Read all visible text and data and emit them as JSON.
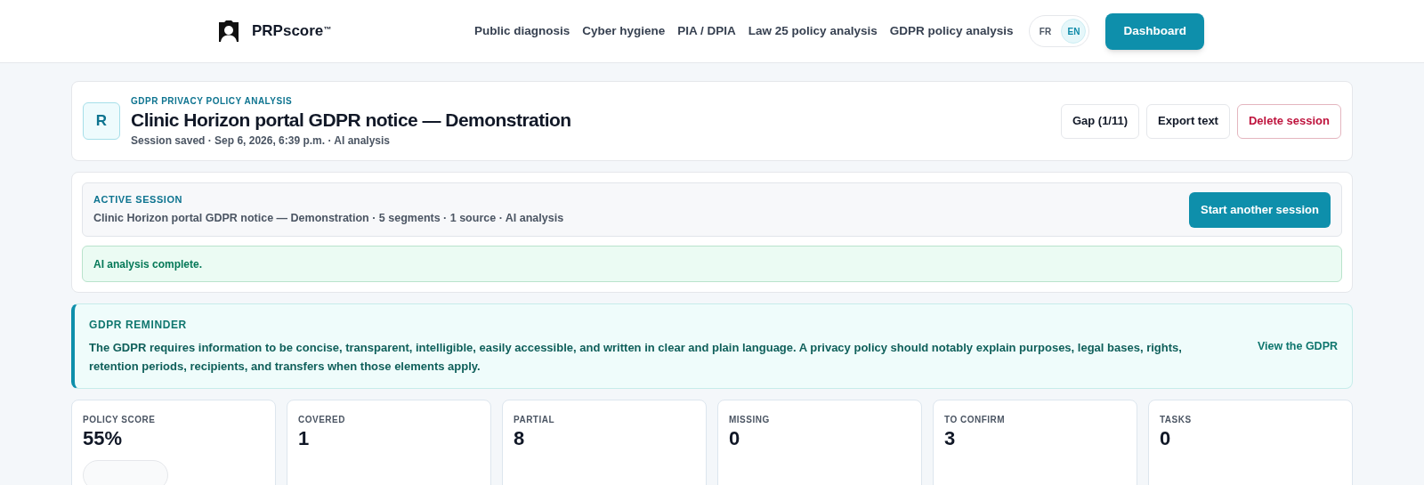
{
  "header": {
    "brand": "PRPscore",
    "brand_mark": "™",
    "nav": [
      "Public diagnosis",
      "Cyber hygiene",
      "PIA / DPIA",
      "Law 25 policy analysis",
      "GDPR policy analysis"
    ],
    "languages": [
      {
        "label": "FR",
        "selected": false
      },
      {
        "label": "EN",
        "selected": true
      }
    ],
    "cta": "Dashboard"
  },
  "session_card": {
    "avatar": "R",
    "eyebrow": "GDPR PRIVACY POLICY ANALYSIS",
    "title": "Clinic Horizon portal GDPR notice — Demonstration",
    "meta": "Session saved · Sep 6, 2026, 6:39 p.m. · AI analysis",
    "actions": [
      {
        "label": "Gap (1/11)",
        "kind": "default"
      },
      {
        "label": "Export text",
        "kind": "default"
      },
      {
        "label": "Delete session",
        "kind": "danger"
      }
    ]
  },
  "active_session": {
    "eyebrow": "ACTIVE SESSION",
    "summary": "Clinic Horizon portal GDPR notice — Demonstration · 5 segments · 1 source · AI analysis",
    "button": "Start another session",
    "status": "AI analysis complete."
  },
  "reminder": {
    "title": "GDPR REMINDER",
    "text": "The GDPR requires information to be concise, transparent, intelligible, easily accessible, and written in clear and plain language. A privacy policy should notably explain purposes, legal bases, rights, retention periods, recipients, and transfers when those elements apply.",
    "link": "View the GDPR"
  },
  "stats": [
    {
      "label": "POLICY SCORE",
      "value": "55%",
      "kind": "score"
    },
    {
      "label": "COVERED",
      "value": "1",
      "kind": "plain"
    },
    {
      "label": "PARTIAL",
      "value": "8",
      "kind": "plain"
    },
    {
      "label": "MISSING",
      "value": "0",
      "kind": "plain"
    },
    {
      "label": "TO CONFIRM",
      "value": "3",
      "kind": "plain"
    },
    {
      "label": "TASKS",
      "value": "0",
      "kind": "plain"
    }
  ]
}
